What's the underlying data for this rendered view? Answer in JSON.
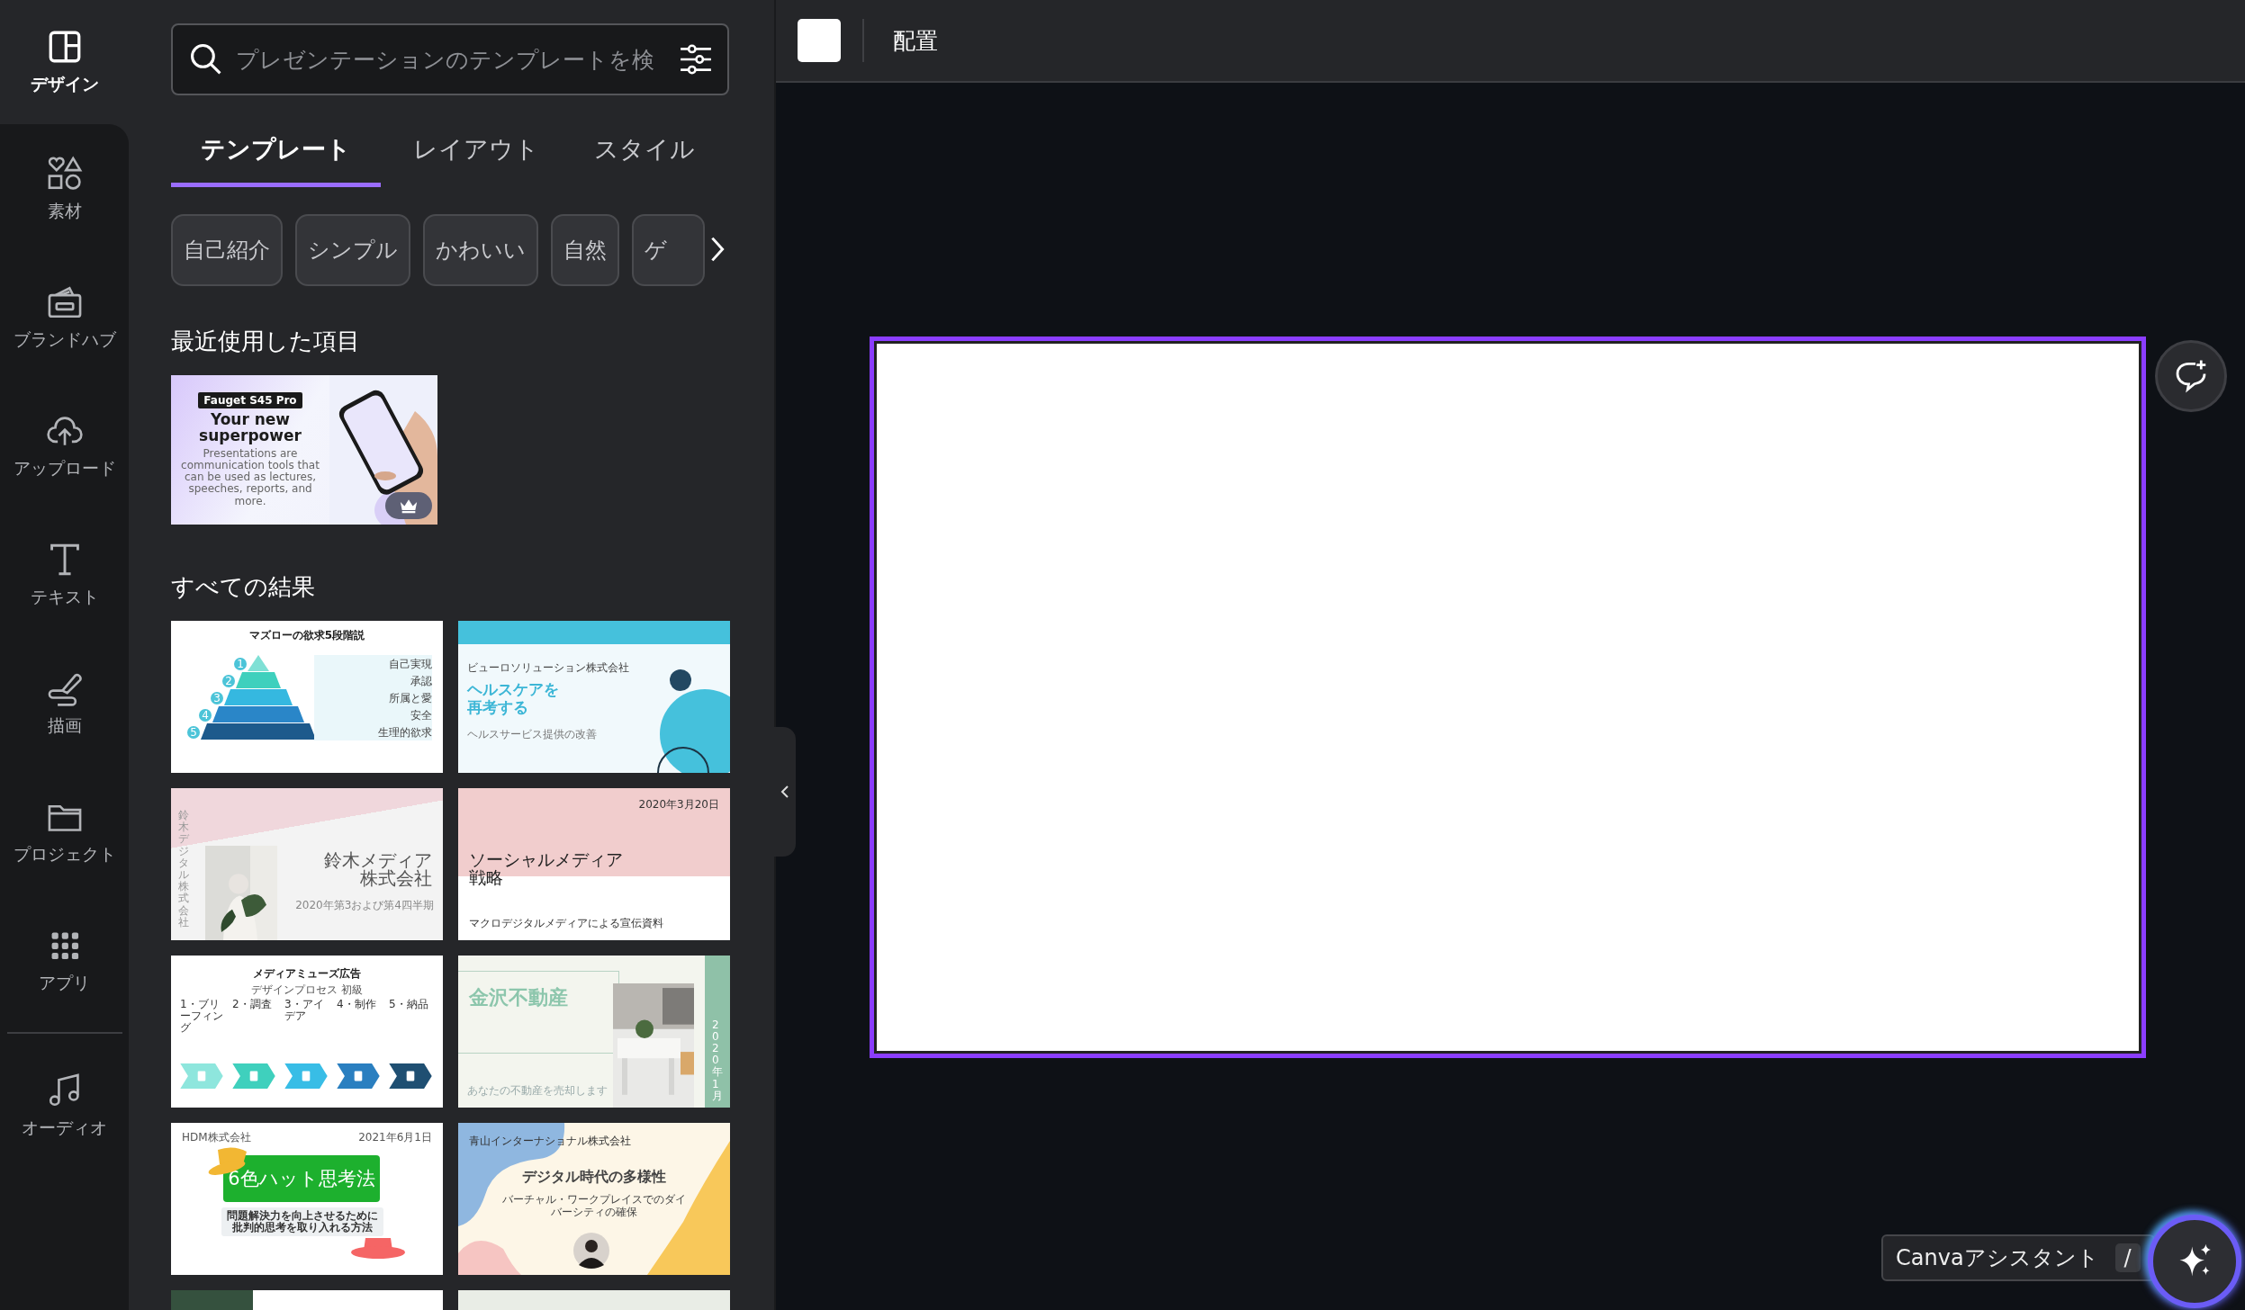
{
  "rail": {
    "items": [
      {
        "label": "デザイン",
        "selected": true
      },
      {
        "label": "素材",
        "selected": false
      },
      {
        "label": "ブランドハブ",
        "selected": false
      },
      {
        "label": "アップロード",
        "selected": false
      },
      {
        "label": "テキスト",
        "selected": false
      },
      {
        "label": "描画",
        "selected": false
      },
      {
        "label": "プロジェクト",
        "selected": false
      },
      {
        "label": "アプリ",
        "selected": false
      }
    ],
    "bottom_items": [
      {
        "label": "オーディオ",
        "selected": false
      }
    ]
  },
  "search": {
    "placeholder": "プレゼンテーションのテンプレートを検"
  },
  "tabs": [
    {
      "label": "テンプレート",
      "selected": true
    },
    {
      "label": "レイアウト",
      "selected": false
    },
    {
      "label": "スタイル",
      "selected": false
    }
  ],
  "chips": [
    "自己紹介",
    "シンプル",
    "かわいい",
    "自然",
    "ゲ"
  ],
  "recent": {
    "title": "最近使用した項目",
    "item": {
      "badge": "Fauget S45 Pro",
      "title": [
        "Your new",
        "superpower"
      ],
      "body": "Presentations are communication tools that can be used as lectures, speeches, reports, and more.",
      "premium": true
    }
  },
  "results": {
    "title": "すべての結果",
    "templates": [
      {
        "kind": "pyramid",
        "title": "マズローの欲求5段階説",
        "levels": [
          {
            "num": "1",
            "label": "自己実現"
          },
          {
            "num": "2",
            "label": "承認"
          },
          {
            "num": "3",
            "label": "所属と愛"
          },
          {
            "num": "4",
            "label": "安全"
          },
          {
            "num": "5",
            "label": "生理的欲求"
          }
        ]
      },
      {
        "kind": "health",
        "company": "ビューロソリューション株式会社",
        "title": [
          "ヘルスケアを",
          "再考する"
        ],
        "subtitle": "ヘルスサービス提供の改善"
      },
      {
        "kind": "photo_title",
        "side": "鈴木デジタル株式会社",
        "title": [
          "鈴木メディア",
          "株式会社"
        ],
        "subtitle": "2020年第3および第4四半期"
      },
      {
        "kind": "banner",
        "date": "2020年3月20日",
        "title": [
          "ソーシャルメディア",
          "戦略"
        ],
        "subtitle": "マクロデジタルメディアによる宣伝資料"
      },
      {
        "kind": "process",
        "title": "メディアミューズ広告",
        "subtitle": "デザインプロセス 初級",
        "steps": [
          "1・ブリーフィング",
          "2・調査",
          "3・アイデア",
          "4・制作",
          "5・納品"
        ]
      },
      {
        "kind": "realestate",
        "title": "金沢不動産",
        "subtitle": "あなたの不動産を売却します",
        "side": "2020年1月"
      },
      {
        "kind": "hats",
        "company": "HDM株式会社",
        "date": "2021年6月1日",
        "title": "6色ハット思考法",
        "subtitle": [
          "問題解決力を向上させるために",
          "批判的思考を取り入れる方法"
        ]
      },
      {
        "kind": "blobs",
        "company": "青山インターナショナル株式会社",
        "title": "デジタル時代の多様性",
        "subtitle": "バーチャル・ワークプレイスでのダイバーシティの確保"
      },
      {
        "kind": "cut"
      },
      {
        "kind": "cut"
      }
    ]
  },
  "toolbar": {
    "label": "配置"
  },
  "assistant": {
    "label": "Canvaアシスタント",
    "shortcut": "/"
  }
}
